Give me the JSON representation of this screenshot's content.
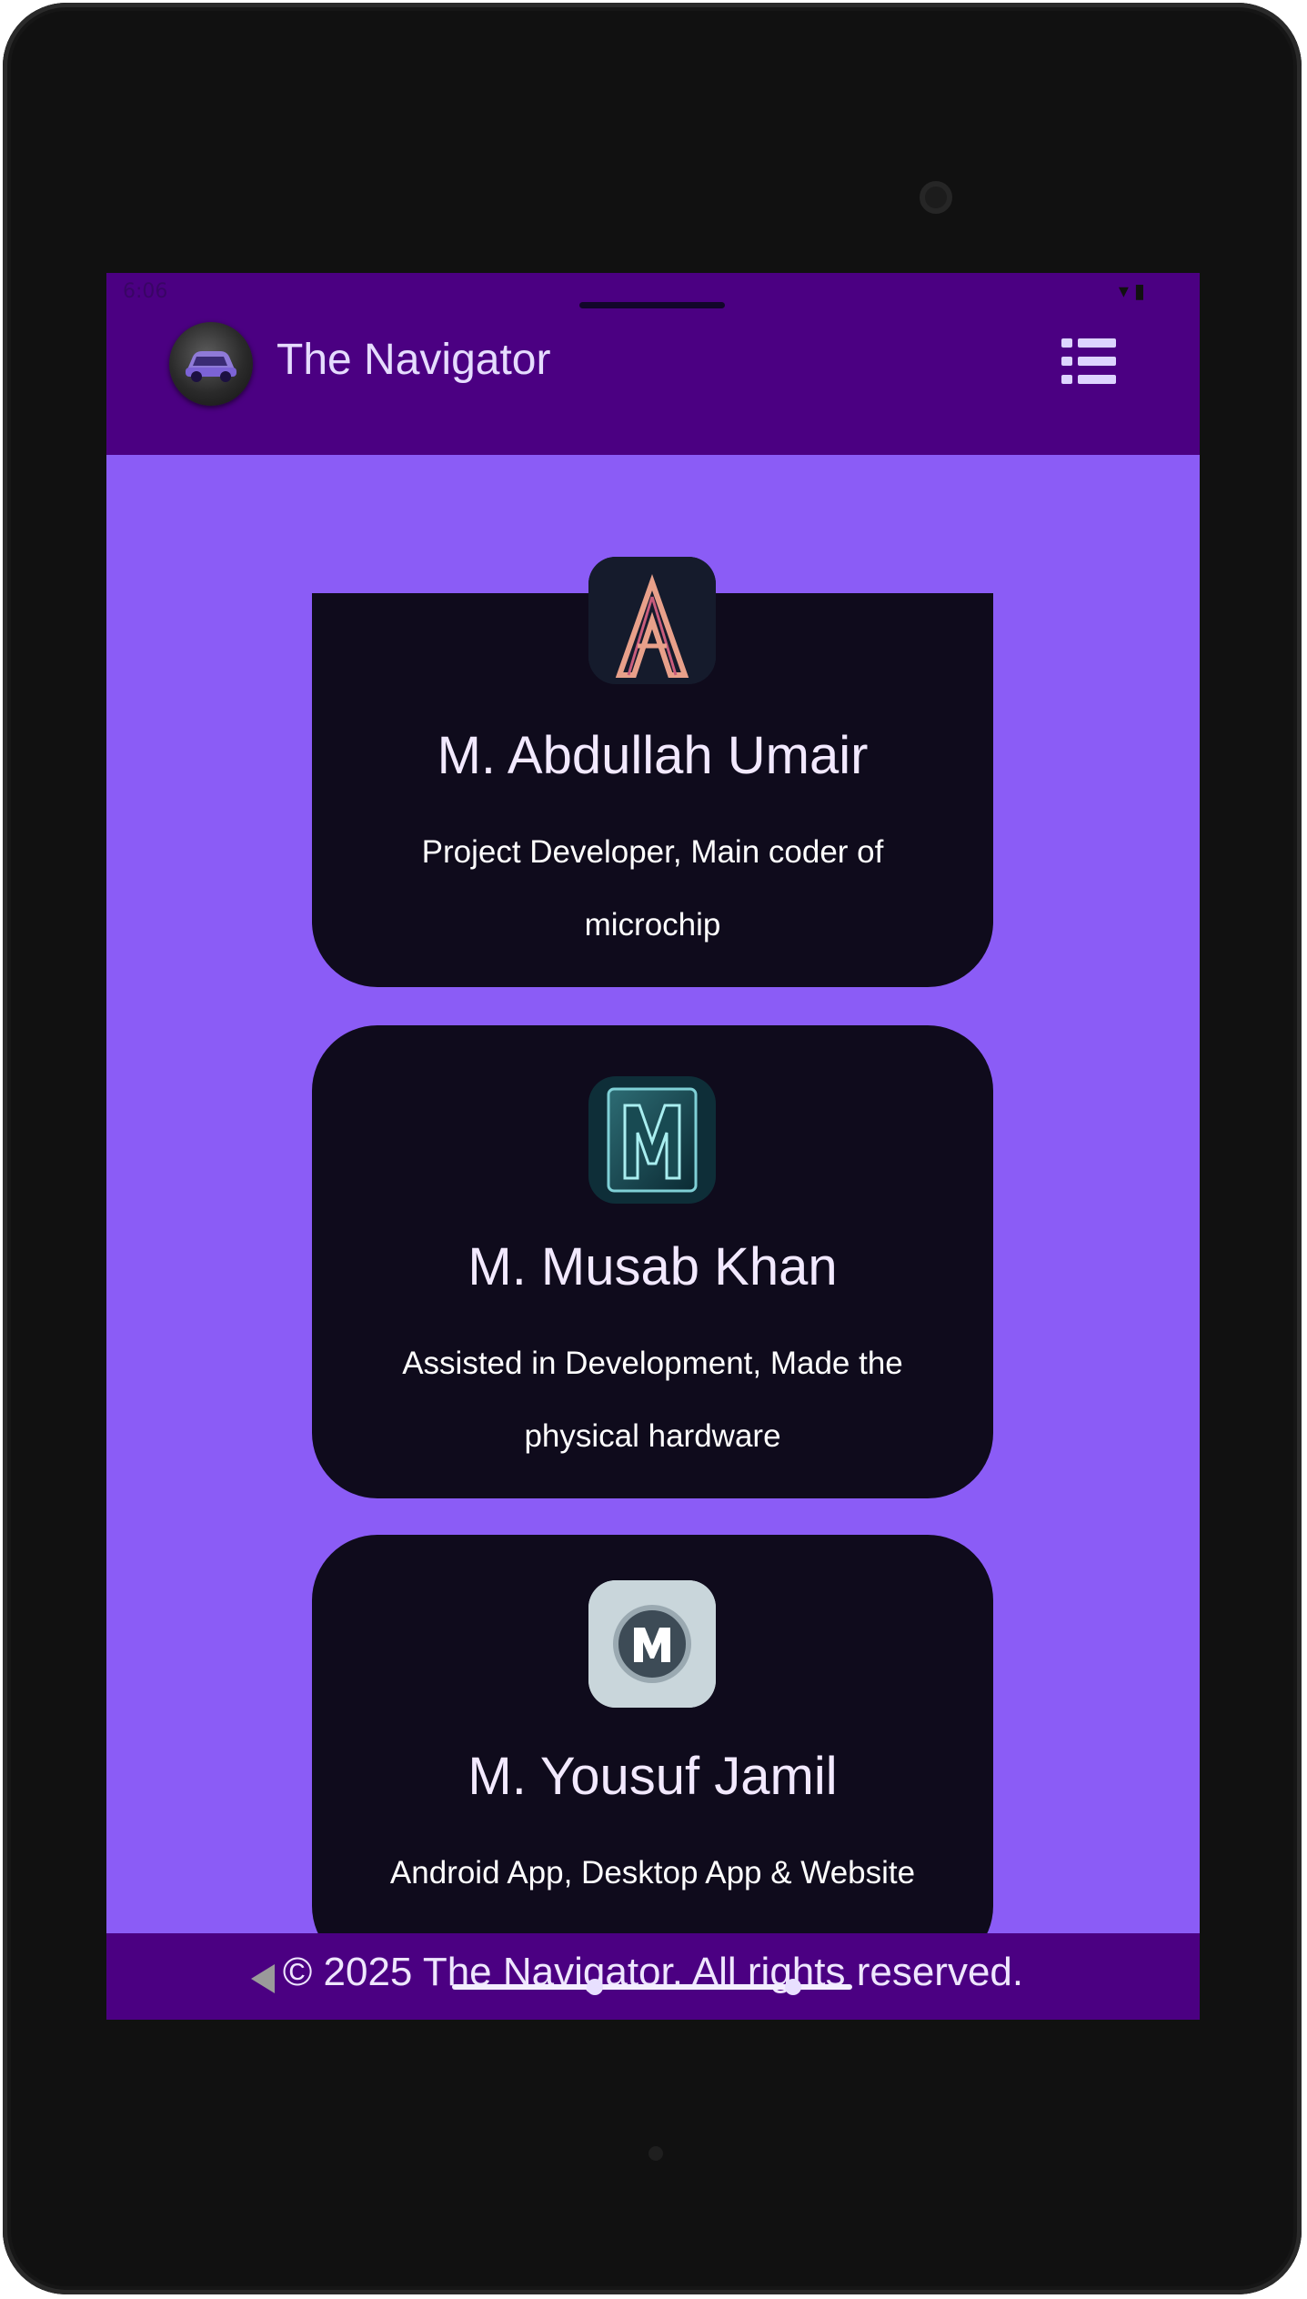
{
  "status": {
    "time": "6:06",
    "icons": [
      "wifi-icon",
      "battery-icon"
    ]
  },
  "appbar": {
    "title": "The Navigator",
    "logo": "car-logo-icon",
    "menu_icon": "list-menu-icon"
  },
  "team": [
    {
      "name": "M. Abdullah Umair",
      "role": "Project Developer, Main coder of microchip",
      "avatar": "letter-a-logo"
    },
    {
      "name": "M. Musab Khan",
      "role": "Assisted in Development, Made the physical hardware",
      "avatar": "letter-m-metal-logo"
    },
    {
      "name": "M. Yousuf Jamil",
      "role": "Android App, Desktop App & Website",
      "avatar": "letter-m-circle-logo"
    }
  ],
  "footer": {
    "text": "© 2025 The Navigator. All rights reserved."
  },
  "colors": {
    "appbar": "#4b0082",
    "background": "#8b5cf6",
    "card": "#0f0b1c"
  }
}
